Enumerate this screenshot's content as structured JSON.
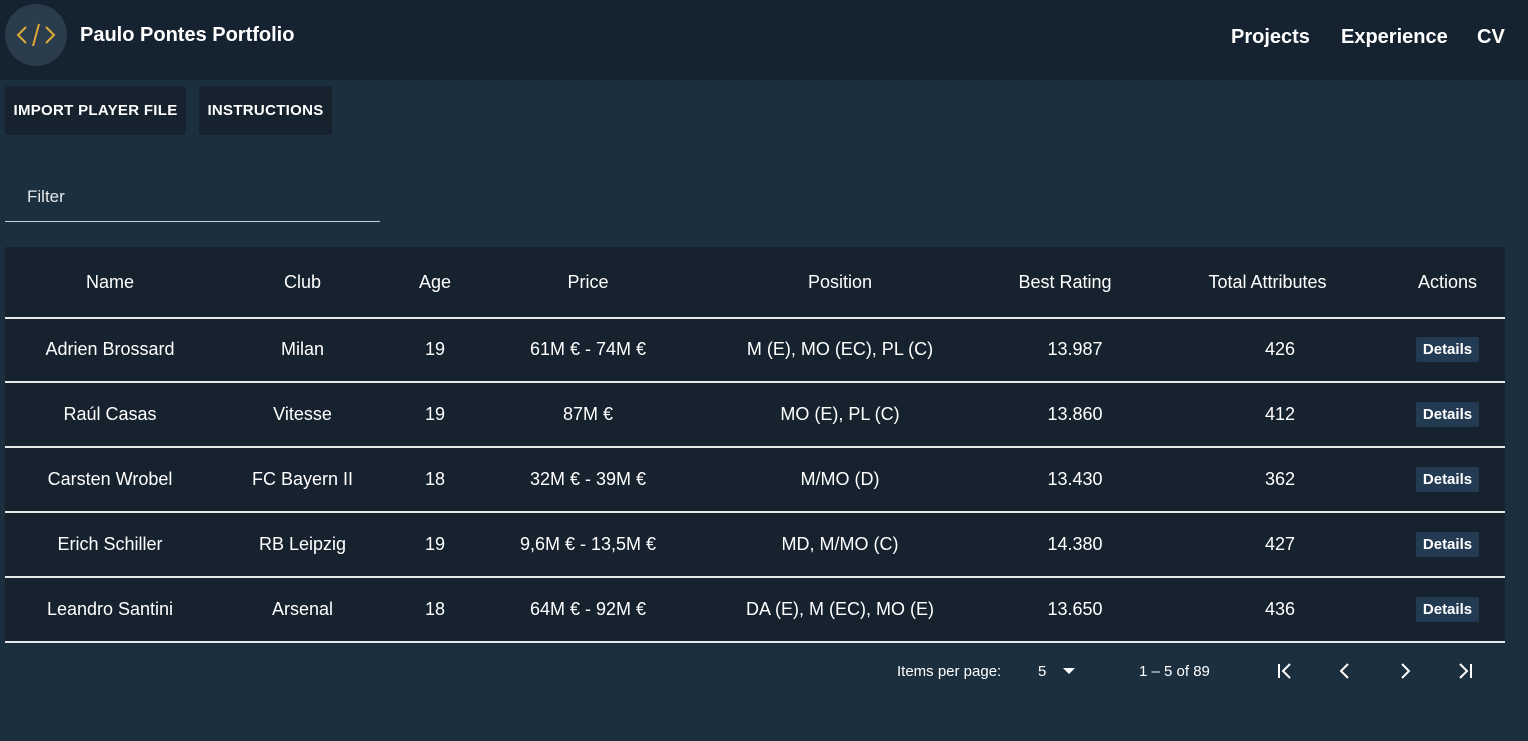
{
  "header": {
    "brand": "Paulo Pontes Portfolio",
    "nav": [
      "Projects",
      "Experience",
      "CV"
    ]
  },
  "toolbar": {
    "import_label": "IMPORT PLAYER FILE",
    "instructions_label": "INSTRUCTIONS"
  },
  "filter": {
    "placeholder": "Filter"
  },
  "table": {
    "columns": [
      "Name",
      "Club",
      "Age",
      "Price",
      "Position",
      "Best Rating",
      "Total Attributes",
      "Actions"
    ],
    "rows": [
      {
        "name": "Adrien Brossard",
        "club": "Milan",
        "age": "19",
        "price": "61M € - 74M €",
        "position": "M (E), MO (EC), PL (C)",
        "rating": "13.987",
        "total": "426",
        "action": "Details"
      },
      {
        "name": "Raúl Casas",
        "club": "Vitesse",
        "age": "19",
        "price": "87M €",
        "position": "MO (E), PL (C)",
        "rating": "13.860",
        "total": "412",
        "action": "Details"
      },
      {
        "name": "Carsten Wrobel",
        "club": "FC Bayern II",
        "age": "18",
        "price": "32M € - 39M €",
        "position": "M/MO (D)",
        "rating": "13.430",
        "total": "362",
        "action": "Details"
      },
      {
        "name": "Erich Schiller",
        "club": "RB Leipzig",
        "age": "19",
        "price": "9,6M € - 13,5M €",
        "position": "MD, M/MO (C)",
        "rating": "14.380",
        "total": "427",
        "action": "Details"
      },
      {
        "name": "Leandro Santini",
        "club": "Arsenal",
        "age": "18",
        "price": "64M € - 92M €",
        "position": "DA (E), M (EC), MO (E)",
        "rating": "13.650",
        "total": "436",
        "action": "Details"
      }
    ]
  },
  "paginator": {
    "items_per_page_label": "Items per page:",
    "page_size": "5",
    "range_label": "1 – 5 of 89"
  },
  "colors": {
    "background": "#1c2f3f",
    "topbar": "#152330",
    "table": "#16222e",
    "details_button": "#223a52",
    "logo_accent": "#e0a93a"
  },
  "icons": {
    "logo": "code-brackets-icon",
    "page_size_dropdown": "caret-down-icon",
    "first_page": "first-page-icon",
    "prev_page": "chevron-left-icon",
    "next_page": "chevron-right-icon",
    "last_page": "last-page-icon"
  }
}
